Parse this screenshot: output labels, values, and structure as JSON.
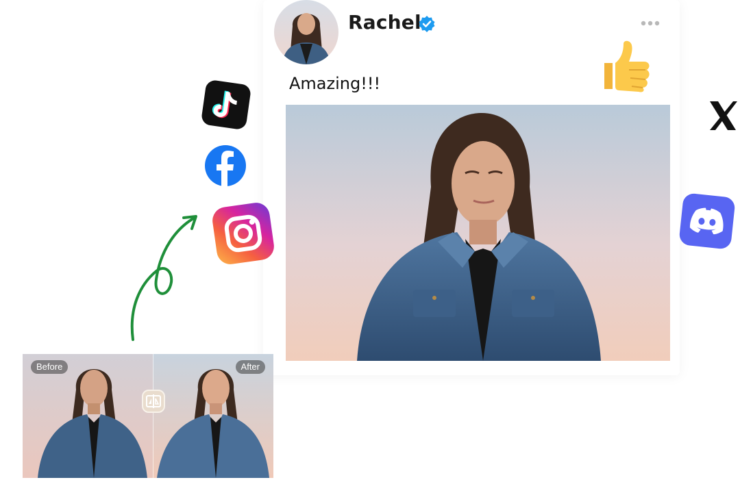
{
  "post": {
    "username": "Rachel",
    "text": "Amazing!!!"
  },
  "compare": {
    "before_label": "Before",
    "after_label": "After"
  },
  "colors": {
    "verified": "#1d9bf0",
    "arrow": "#1f8f3a",
    "facebook": "#1877f2",
    "discord": "#5865f2",
    "tiktok_bg": "#111111"
  },
  "icons": [
    "verified-badge-icon",
    "more-options-icon",
    "thumbs-up-icon",
    "tiktok-icon",
    "facebook-icon",
    "instagram-icon",
    "x-icon",
    "discord-icon",
    "compare-handle-icon"
  ]
}
